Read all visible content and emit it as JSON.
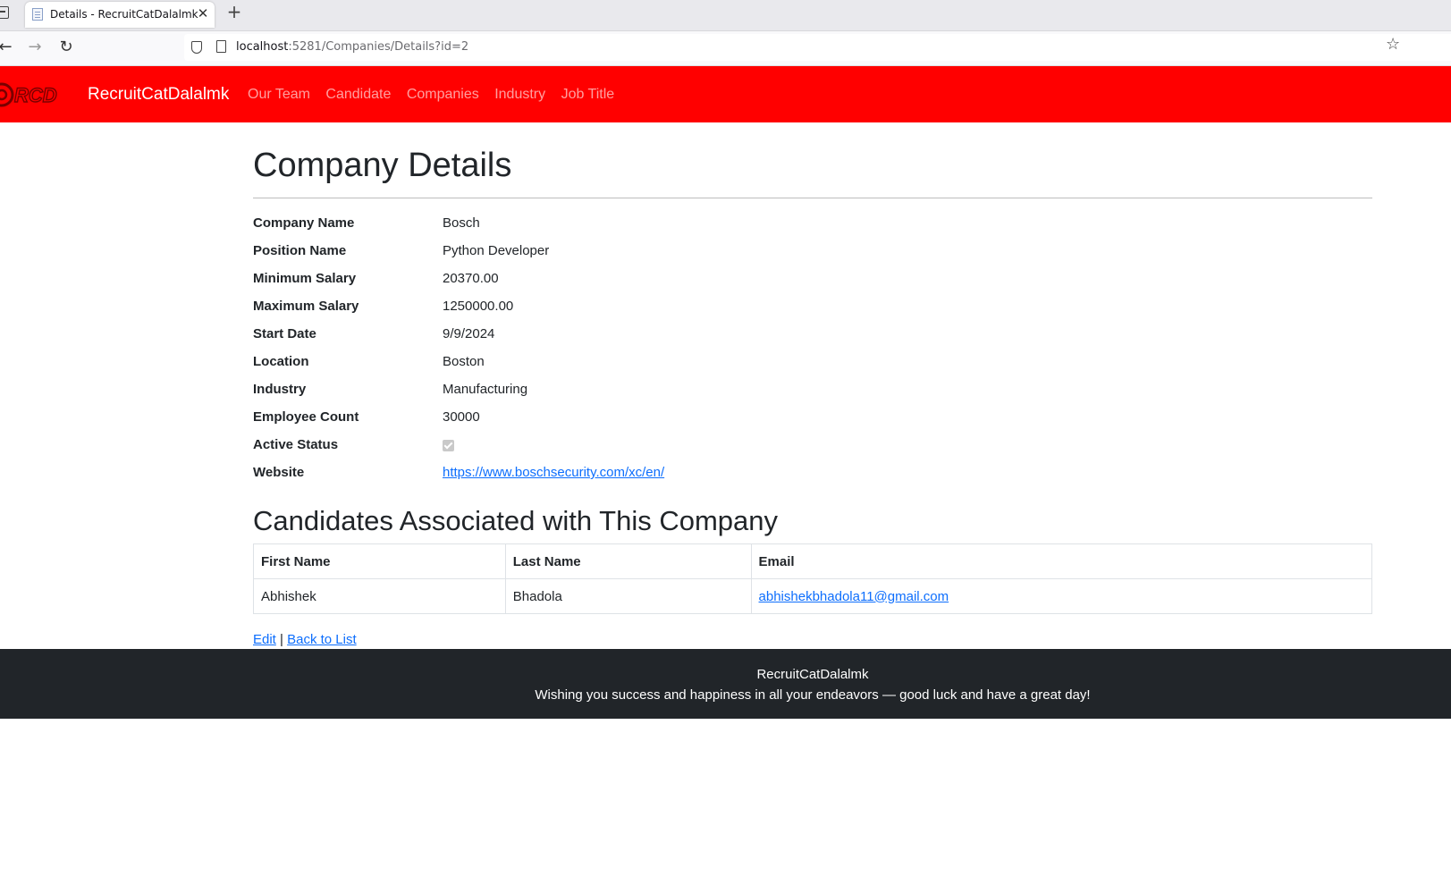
{
  "browser": {
    "tab_title": "Details - RecruitCatDalalmk",
    "tab_close": "✕",
    "new_tab": "+",
    "url_host": "localhost",
    "url_rest": ":5281/Companies/Details?id=2"
  },
  "navbar": {
    "brand": "RecruitCatDalalmk",
    "logo_text": "RCD",
    "links": [
      {
        "label": "Our Team"
      },
      {
        "label": "Candidate"
      },
      {
        "label": "Companies"
      },
      {
        "label": "Industry"
      },
      {
        "label": "Job Title"
      }
    ]
  },
  "page": {
    "title": "Company Details",
    "details": [
      {
        "label": "Company Name",
        "value": "Bosch"
      },
      {
        "label": "Position Name",
        "value": "Python Developer"
      },
      {
        "label": "Minimum Salary",
        "value": "20370.00"
      },
      {
        "label": "Maximum Salary",
        "value": "1250000.00"
      },
      {
        "label": "Start Date",
        "value": "9/9/2024"
      },
      {
        "label": "Location",
        "value": "Boston"
      },
      {
        "label": "Industry",
        "value": "Manufacturing"
      },
      {
        "label": "Employee Count",
        "value": "30000"
      },
      {
        "label": "Active Status",
        "checked": true
      },
      {
        "label": "Website",
        "value": "https://www.boschsecurity.com/xc/en/"
      }
    ],
    "candidates_title": "Candidates Associated with This Company",
    "candidates_table": {
      "headers": [
        "First Name",
        "Last Name",
        "Email"
      ],
      "rows": [
        [
          "Abhishek",
          "Bhadola",
          "abhishekbhadola11@gmail.com"
        ]
      ]
    },
    "actions": {
      "edit": "Edit",
      "separator": "|",
      "back": "Back to List"
    }
  },
  "footer": {
    "name": "RecruitCatDalalmk",
    "message": "Wishing you success and happiness in all your endeavors — good luck and have a great day!"
  },
  "colors": {
    "navbar": "#ff0000",
    "footer": "#212529",
    "link": "#0d6efd"
  }
}
